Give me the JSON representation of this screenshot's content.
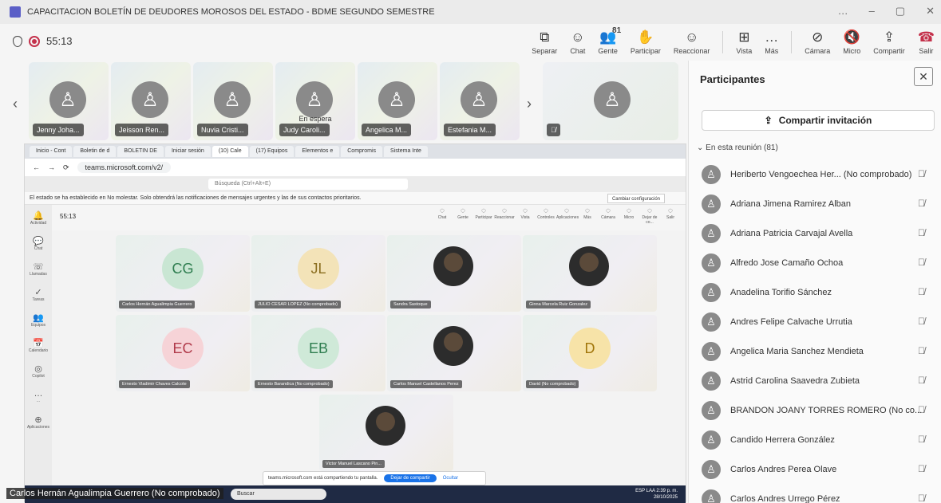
{
  "window": {
    "title": "CAPACITACION BOLETÍN DE DEUDORES MOROSOS DEL ESTADO - BDME SEGUNDO SEMESTRE",
    "controls": [
      "…",
      "–",
      "▢",
      "✕"
    ]
  },
  "meeting": {
    "timer": "55:13",
    "toolbar": [
      {
        "id": "separar",
        "icon": "⧉",
        "label": "Separar"
      },
      {
        "id": "chat",
        "icon": "☺",
        "label": "Chat"
      },
      {
        "id": "gente",
        "icon": "👥",
        "label": "Gente",
        "count": "81"
      },
      {
        "id": "participar",
        "icon": "✋",
        "label": "Participar"
      },
      {
        "id": "reaccionar",
        "icon": "☺",
        "label": "Reaccionar"
      },
      {
        "id": "vista",
        "icon": "⊞",
        "label": "Vista"
      },
      {
        "id": "mas",
        "icon": "…",
        "label": "Más"
      },
      {
        "id": "camara",
        "icon": "⊘",
        "label": "Cámara"
      },
      {
        "id": "micro",
        "icon": "🔇",
        "label": "Micro"
      },
      {
        "id": "compartir",
        "icon": "⇪",
        "label": "Compartir"
      },
      {
        "id": "salir",
        "icon": "☎",
        "label": "Salir"
      }
    ]
  },
  "strip": {
    "tiles": [
      {
        "name": "Jenny Joha..."
      },
      {
        "name": "Jeisson Ren..."
      },
      {
        "name": "Nuvia Cristi..."
      },
      {
        "name": "Judy Caroli...",
        "hold": "En espera"
      },
      {
        "name": "Angelica M..."
      },
      {
        "name": "Estefania M..."
      }
    ],
    "big_tile": {
      "name": ""
    }
  },
  "shared": {
    "tabs": [
      "Inicio - Cont",
      "Boletin de d",
      "BOLETIN DE",
      "Iniciar sesión",
      "(10) Cale",
      "(17) Equipos",
      "Elementos e",
      "Compromis",
      "Sistema Inte"
    ],
    "url": "teams.microsoft.com/v2/",
    "search_placeholder": "Búsqueda (Ctrl+Alt+E)",
    "notice": "El estado se ha establecido en No molestar. Solo obtendrá las notificaciones de mensajes urgentes y las de sus contactos prioritarios.",
    "notice_btn": "Cambiar configuración",
    "rail": [
      "Actividad",
      "Chat",
      "Llamadas",
      "Tareas",
      "Equipos",
      "Calendario",
      "Copilot",
      "...",
      "Aplicaciones"
    ],
    "inner_timer": "55:13",
    "inner_buttons": [
      "Chat",
      "Gente",
      "Participar",
      "Reaccionar",
      "Vista",
      "Controles",
      "Aplicaciones",
      "Más",
      "Cámara",
      "Micro",
      "Dejar de co...",
      "Salir"
    ],
    "tiles": [
      {
        "initials": "CG",
        "label": "Carlos Hernán Agualimpia Guerrero",
        "color": "#2e7d4f",
        "bg": "#c9e6d3"
      },
      {
        "initials": "JL",
        "label": "JULIO CESAR LOPEZ (No comprobado)",
        "color": "#8a6d1e",
        "bg": "#f3e3b8"
      },
      {
        "initials": "",
        "label": "Sandra Sastoque",
        "photo": true
      },
      {
        "initials": "",
        "label": "Ginna Marcela Ruiz Gonzalez",
        "photo": true
      },
      {
        "initials": "EC",
        "label": "Ernesto Vladimir Chaves Calcote",
        "color": "#b03a4a",
        "bg": "#f6d3d7"
      },
      {
        "initials": "EB",
        "label": "Ernesto Barandica (No comprobado)",
        "color": "#2e7d4f",
        "bg": "#cfe9d8"
      },
      {
        "initials": "",
        "label": "Carlos Manuel Castellanos Perez",
        "photo": true
      },
      {
        "initials": "D",
        "label": "David (No comprobado)",
        "color": "#a1750a",
        "bg": "#f7e3a8"
      },
      {
        "initials": "",
        "label": "Victor Manuel Lascano Pin...",
        "photo": true
      }
    ],
    "share_msg": "teams.microsoft.com está compartiendo tu pantalla.",
    "stop_share": "Dejar de compartir",
    "hide": "Ocultar",
    "taskbar_search": "Buscar",
    "clock_time": "2:39 p. m.",
    "clock_date": "28/10/2025",
    "lang": "ESP LAA"
  },
  "presenter": "Carlos Hernán Agualimpia Guerrero (No comprobado)",
  "panel": {
    "title": "Participantes",
    "invite": "Compartir invitación",
    "section": "En esta reunión (81)",
    "people": [
      "Heriberto Vengoechea Her... (No comprobado)",
      "Adriana Jimena Ramirez Alban",
      "Adriana Patricia Carvajal Avella",
      "Alfredo Jose Camaño Ochoa",
      "Anadelina Torifio Sánchez",
      "Andres Felipe Calvache Urrutia",
      "Angelica Maria Sanchez Mendieta",
      "Astrid Carolina Saavedra Zubieta",
      "BRANDON JOANY TORRES ROMERO (No co...",
      "Candido Herrera González",
      "Carlos Andres Perea Olave",
      "Carlos Andres Urrego Pérez"
    ]
  }
}
